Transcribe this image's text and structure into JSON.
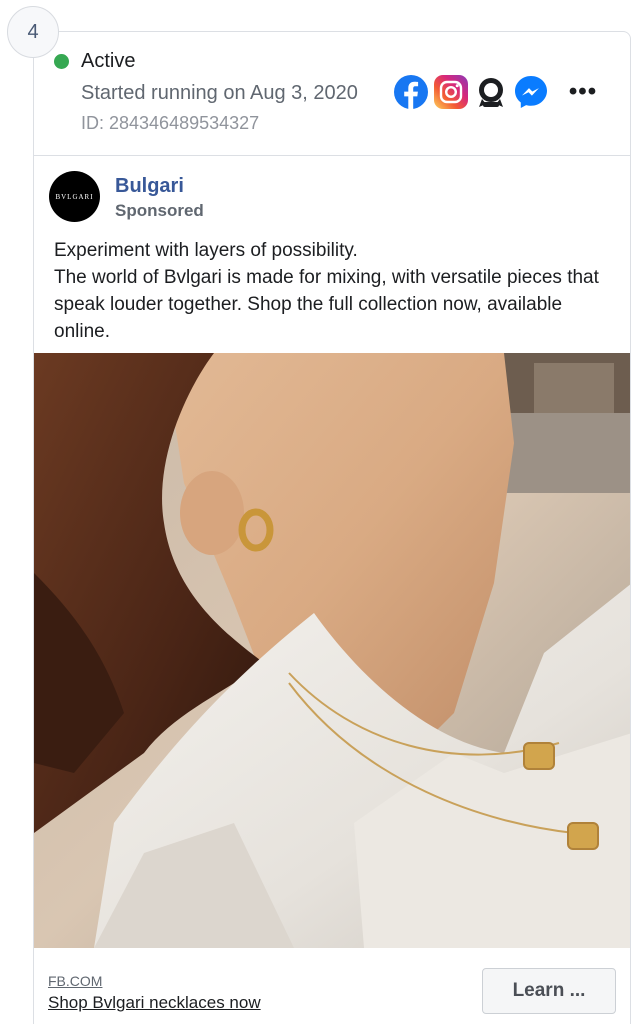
{
  "index_badge": "4",
  "status": {
    "label": "Active",
    "color": "#36a852",
    "started": "Started running on Aug 3, 2020",
    "id": "ID: 284346489534327"
  },
  "platforms": [
    {
      "name": "facebook-icon"
    },
    {
      "name": "instagram-icon"
    },
    {
      "name": "audience-network-icon"
    },
    {
      "name": "messenger-icon"
    }
  ],
  "more_icon": "•••",
  "advertiser": {
    "name": "Bulgari",
    "sponsored": "Sponsored",
    "avatar_text": "BVLGARI"
  },
  "ad_body": {
    "line1": "Experiment with layers of possibility.",
    "line2": "The world of Bvlgari is made for mixing, with versatile pieces that speak louder together. Shop the full collection now, available online."
  },
  "cta": {
    "domain": "FB.COM",
    "title": "Shop Bvlgari necklaces now",
    "button": "Learn ..."
  },
  "colors": {
    "advertiser_name": "#385898",
    "status_active": "#36a852",
    "facebook_blue": "#1877f2",
    "messenger_blue": "#0a7cff"
  }
}
